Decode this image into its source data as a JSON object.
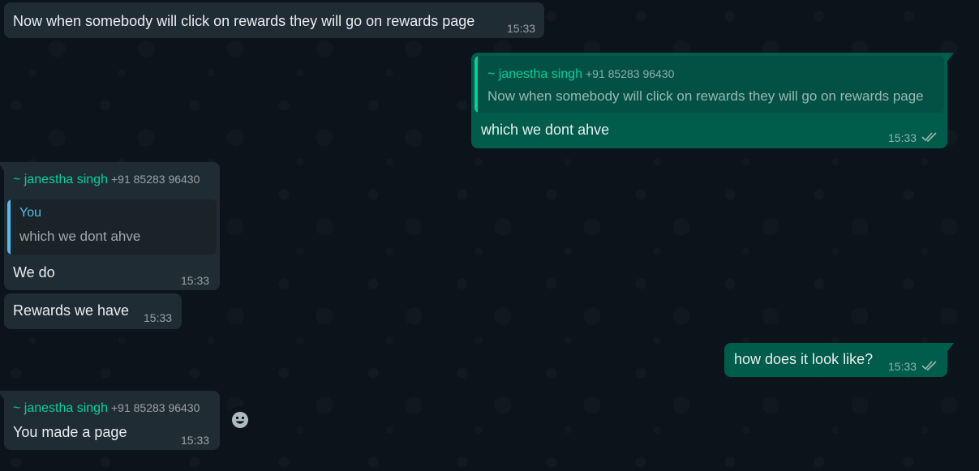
{
  "messages": [
    {
      "id": "m1",
      "direction": "incoming",
      "text": "Now when somebody will click on rewards they will go on rewards page",
      "time": "15:33"
    },
    {
      "id": "m2",
      "direction": "outgoing",
      "quote": {
        "sender": "~ janestha singh",
        "phone": "+91 85283 96430",
        "text": "Now when somebody will click on rewards they will go on rewards page"
      },
      "text": "which we dont ahve",
      "time": "15:33",
      "status": "read"
    },
    {
      "id": "m3",
      "direction": "incoming",
      "sender": "~ janestha singh",
      "phone": "+91 85283 96430",
      "quote": {
        "sender": "You",
        "text": "which we dont ahve"
      },
      "text": "We do",
      "time": "15:33"
    },
    {
      "id": "m4",
      "direction": "incoming",
      "text": "Rewards we have",
      "time": "15:33"
    },
    {
      "id": "m5",
      "direction": "outgoing",
      "text": "how does it look like?",
      "time": "15:33",
      "status": "read"
    },
    {
      "id": "m6",
      "direction": "incoming",
      "sender": "~ janestha singh",
      "phone": "+91 85283 96430",
      "text": "You made a page",
      "time": "15:33"
    }
  ],
  "colors": {
    "background": "#0b141a",
    "incoming_bubble": "#202c33",
    "outgoing_bubble": "#005c4b",
    "sender_name": "#06cf9c",
    "quote_you": "#53bdeb",
    "read_ticks": "#a0b4b0"
  },
  "icons": {
    "reaction": "smiley-icon",
    "read_status": "double-check-icon"
  }
}
